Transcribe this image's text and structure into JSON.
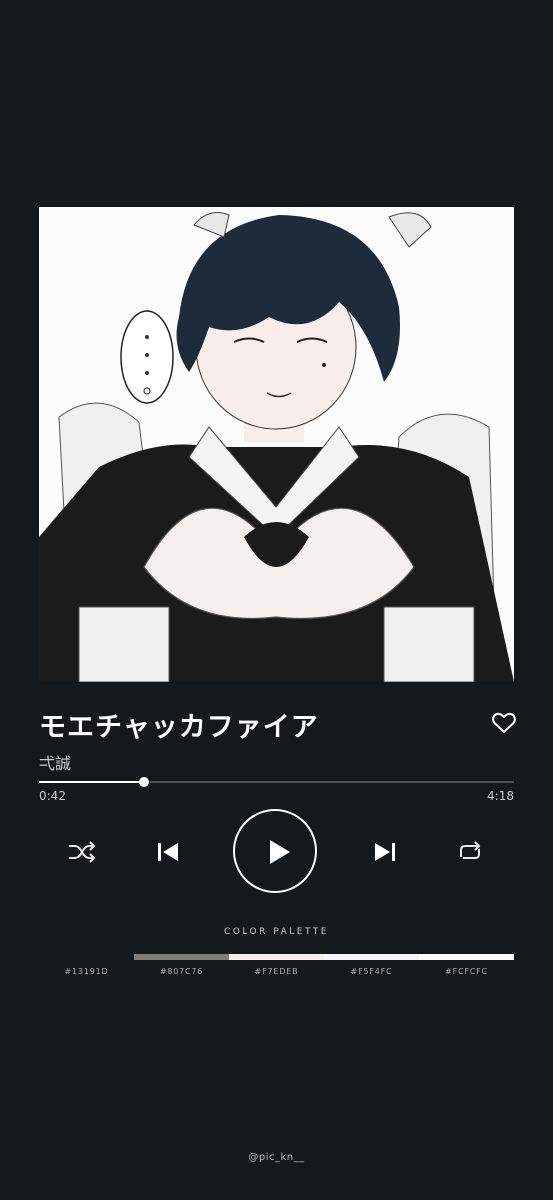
{
  "song": {
    "title": "モエチャッカファイア",
    "artist": "弌誠"
  },
  "playback": {
    "current_time": "0:42",
    "total_time": "4:18",
    "progress_fraction": 0.22
  },
  "controls": {
    "shuffle_icon": "shuffle-icon",
    "previous_icon": "skip-previous-icon",
    "play_icon": "play-icon",
    "next_icon": "skip-next-icon",
    "repeat_icon": "repeat-icon",
    "like_icon": "heart-outline-icon"
  },
  "palette": {
    "label": "COLOR PALETTE",
    "colors": [
      {
        "hex": "#13191D",
        "label": "#13191D"
      },
      {
        "hex": "#807C76",
        "label": "#807C76"
      },
      {
        "hex": "#F7EDEB",
        "label": "#F7EDEB"
      },
      {
        "hex": "#F5F4FC",
        "label": "#F5F4FC"
      },
      {
        "hex": "#FCFCFC",
        "label": "#FCFCFC"
      }
    ]
  },
  "credit": "@pic_kn__"
}
